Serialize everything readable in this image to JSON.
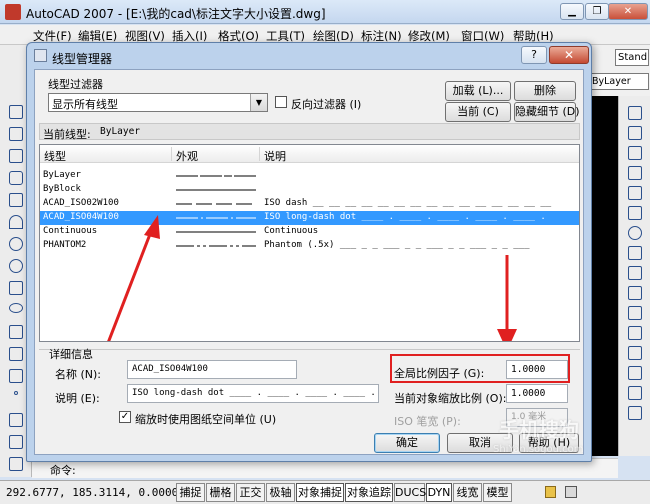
{
  "app": {
    "title": "AutoCAD 2007 - [E:\\我的cad\\标注文字大小设置.dwg]",
    "style_dropdown": "Stand",
    "layer_dropdown": "ByLayer"
  },
  "menu": [
    "文件(F)",
    "编辑(E)",
    "视图(V)",
    "插入(I)",
    "格式(O)",
    "工具(T)",
    "绘图(D)",
    "标注(N)",
    "修改(M)",
    "窗口(W)",
    "帮助(H)"
  ],
  "dialog": {
    "title": "线型管理器",
    "help_label": "?",
    "close_label": "✕",
    "filter": {
      "group_label": "线型过滤器",
      "selected": "显示所有线型",
      "invert_label": "反向过滤器 (I)",
      "invert_checked": false
    },
    "buttons": {
      "load": "加载 (L)...",
      "delete": "删除",
      "current": "当前 (C)",
      "hide_details": "隐藏细节 (D)",
      "ok": "确定",
      "cancel": "取消",
      "help": "帮助 (H)"
    },
    "current_linetype_label": "当前线型:",
    "current_linetype_value": "ByLayer",
    "columns": [
      "线型",
      "外观",
      "说明"
    ],
    "rows": [
      {
        "name": "ByLayer",
        "desc": "",
        "pattern": "bylayer"
      },
      {
        "name": "ByBlock",
        "desc": "",
        "pattern": "solid"
      },
      {
        "name": "ACAD_ISO02W100",
        "desc": "ISO dash __ __ __ __ __ __ __ __ __ __ __ __ __ __ __",
        "pattern": "dash"
      },
      {
        "name": "ACAD_ISO04W100",
        "desc": "ISO long-dash dot ____ . ____ . ____ . ____ . ____ .",
        "pattern": "longdashdot"
      },
      {
        "name": "Continuous",
        "desc": "Continuous",
        "pattern": "solid"
      },
      {
        "name": "PHANTOM2",
        "desc": "Phantom (.5x) ___ _ _ ___ _ _ ___ _ _ ___ _ _ ___",
        "pattern": "phantom"
      }
    ],
    "details": {
      "group_label": "详细信息",
      "name_label": "名称 (N):",
      "name_value": "ACAD_ISO04W100",
      "desc_label": "说明 (E):",
      "desc_value": "ISO long-dash dot ____ . ____ . ____ . ____ . _",
      "global_scale_label": "全局比例因子 (G):",
      "global_scale_value": "1.0000",
      "current_scale_label": "当前对象缩放比例 (O):",
      "current_scale_value": "1.0000",
      "pen_width_label": "ISO 笔宽 (P):",
      "pen_width_value": "1.0 毫米",
      "paper_units_label": "缩放时使用图纸空间单位 (U)",
      "paper_units_checked": true
    }
  },
  "command": {
    "prompt": "命令:"
  },
  "status": {
    "coords": "292.6777, 185.3114, 0.0000",
    "buttons": [
      "捕捉",
      "栅格",
      "正交",
      "极轴",
      "对象捕捉",
      "对象追踪",
      "DUCS",
      "DYN",
      "线宽",
      "模型"
    ]
  },
  "watermark": {
    "line1": "手机搜狗",
    "line2": "ShiYan.sogou.com"
  },
  "colors": {
    "selection": "#3399ff",
    "annotation_red": "#e02020",
    "dialog_frame": "#bcd2ec"
  }
}
